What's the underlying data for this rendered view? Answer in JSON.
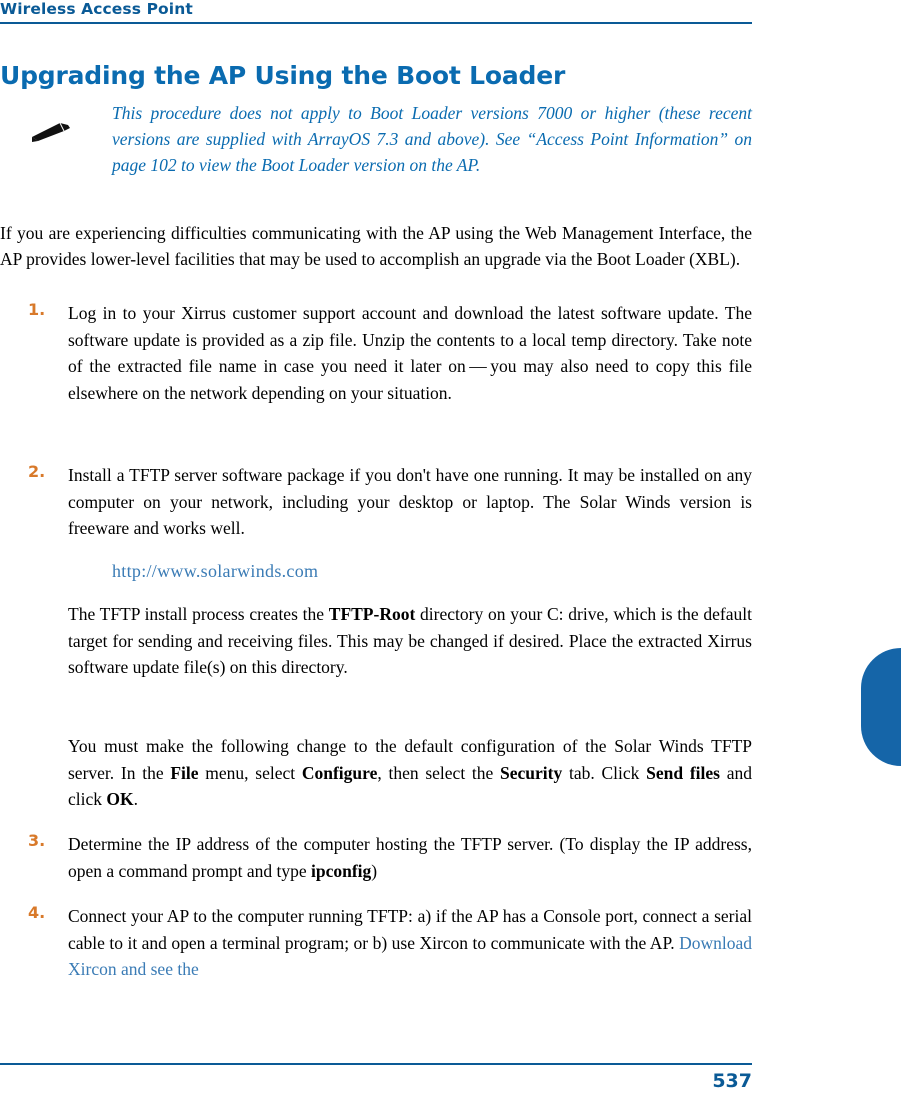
{
  "header": {
    "running_title": "Wireless Access Point"
  },
  "heading": {
    "title": "Upgrading the AP Using the Boot Loader"
  },
  "note": {
    "icon_name": "pencil-note-icon",
    "text": "This procedure does not apply to Boot Loader versions 7000 or higher (these recent versions are supplied with ArrayOS 7.3 and above). See “Access Point Information” on page 102 to view the Boot Loader version on the AP."
  },
  "intro": {
    "text": "If you are experiencing difficulties communicating with the AP using the Web Management Interface, the AP provides lower-level facilities that may be used to accomplish an upgrade via the Boot Loader (XBL)."
  },
  "steps": [
    {
      "number": "1.",
      "text": "Log in to your Xirrus customer support account and download the latest software update. The software update is provided as a zip file. Unzip the contents to a local temp directory. Take note of the extracted file name in case you need it later on — you may also need to copy this file elsewhere on the network depending on your situation."
    },
    {
      "number": "2.",
      "text": "Install a TFTP server software package if you don't have one running. It may be installed on any computer on your network, including your desktop or laptop. The Solar Winds version is freeware and works well."
    },
    {
      "number": "3.",
      "text_part1": "Determine the IP address of the computer hosting the TFTP server. (To display the IP address, open a command prompt and type ",
      "bold1": "ipconfig",
      "text_part2": ")"
    },
    {
      "number": "4.",
      "text_part1": "Connect your AP to the computer running TFTP: a) if the AP has a Console port, connect a serial cable to it and open a terminal program; or b) use Xircon to communicate with the AP. ",
      "link_text": "Download Xircon and see the"
    }
  ],
  "url": {
    "text": "http://www.solarwinds.com"
  },
  "sub_paragraphs": {
    "tftp_install_1": "The TFTP install process creates the ",
    "tftp_install_bold": "TFTP-Root",
    "tftp_install_2": " directory on your C: drive, which is the default target for sending and receiving files. This may be changed if desired. Place the extracted Xirrus software update file(s) on this directory.",
    "solarwinds_1": "You must make the following change to the default configuration of the Solar Winds TFTP server. In the ",
    "solarwinds_bold1": "File",
    "solarwinds_2": " menu, select ",
    "solarwinds_bold2": "Configure",
    "solarwinds_3": ", then select the ",
    "solarwinds_bold3": "Security",
    "solarwinds_4": " tab. Click ",
    "solarwinds_bold4": "Send files",
    "solarwinds_5": " and click ",
    "solarwinds_bold5": "OK",
    "solarwinds_6": "."
  },
  "footer": {
    "page_number": "537"
  },
  "colors": {
    "accent_blue": "#0a6bb0",
    "header_blue": "#0a5a96",
    "step_number_orange": "#d8792a",
    "link_blue": "#3a7bb5",
    "thumb_tab": "#1565a8"
  }
}
